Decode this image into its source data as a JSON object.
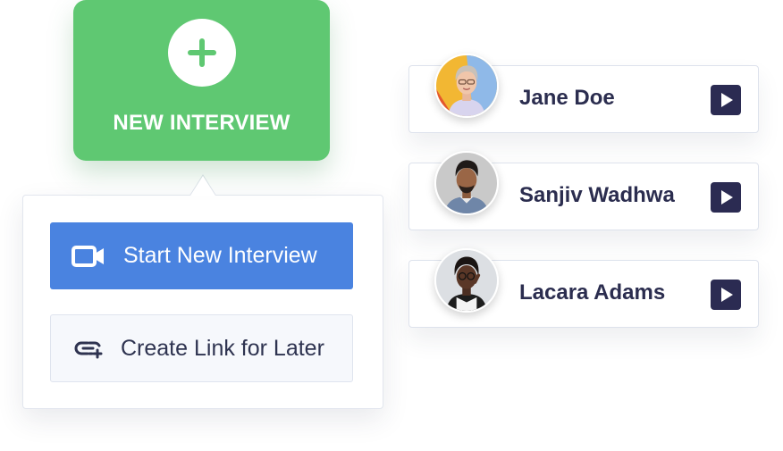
{
  "new_interview": {
    "label": "NEW INTERVIEW",
    "icon": "plus-icon",
    "color": "#5fc872"
  },
  "menu": {
    "start_label": "Start New Interview",
    "start_icon": "video-camera-icon",
    "start_color": "#4a83e0",
    "link_label": "Create Link for Later",
    "link_icon": "link-add-icon"
  },
  "candidates": [
    {
      "name": "Jane Doe",
      "avatar": "avatar-photo",
      "action_icon": "play-icon"
    },
    {
      "name": "Sanjiv Wadhwa",
      "avatar": "avatar-photo",
      "action_icon": "play-icon"
    },
    {
      "name": "Lacara Adams",
      "avatar": "avatar-photo",
      "action_icon": "play-icon"
    }
  ],
  "colors": {
    "name_text": "#2b2d4f",
    "play_button": "#2b2b52"
  }
}
